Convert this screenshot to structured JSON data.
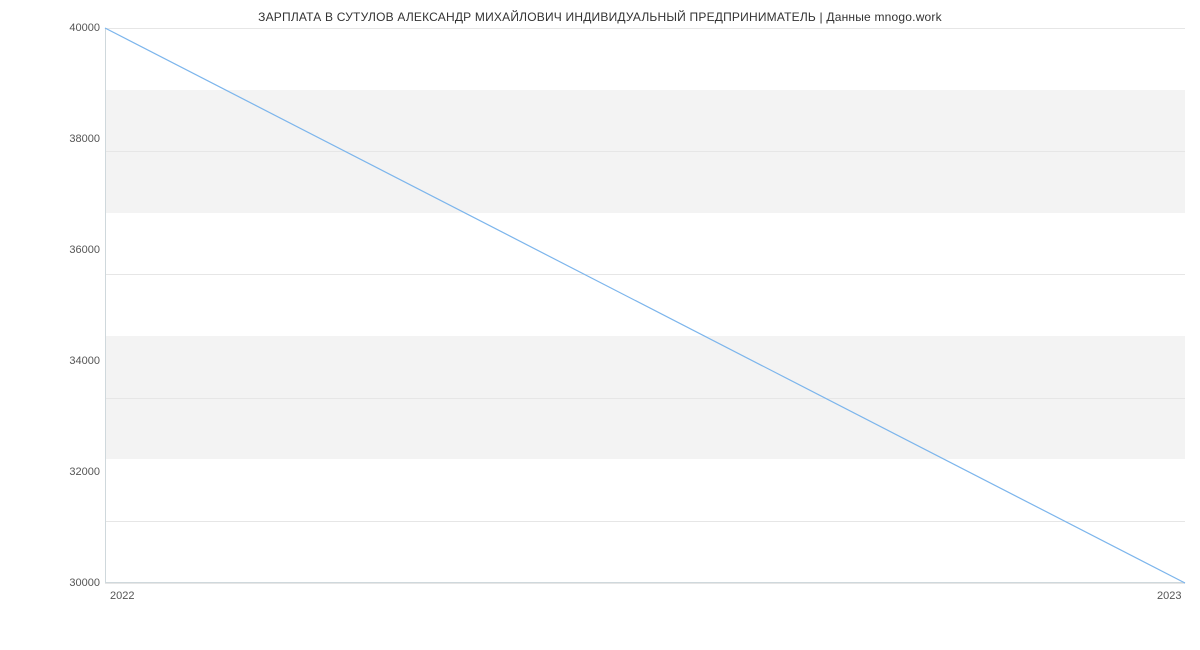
{
  "chart_data": {
    "type": "line",
    "title": "ЗАРПЛАТА В СУТУЛОВ АЛЕКСАНДР МИХАЙЛОВИЧ ИНДИВИДУАЛЬНЫЙ ПРЕДПРИНИМАТЕЛЬ | Данные mnogo.work",
    "xlabel": "",
    "ylabel": "",
    "x_categories": [
      "2022",
      "2023"
    ],
    "y_ticks": [
      30000,
      32000,
      34000,
      36000,
      38000,
      40000
    ],
    "ylim": [
      30000,
      40000
    ],
    "series": [
      {
        "name": "salary",
        "x": [
          "2022",
          "2023"
        ],
        "y": [
          40000,
          30000
        ]
      }
    ],
    "grid": {
      "horizontal_bands": true
    }
  }
}
